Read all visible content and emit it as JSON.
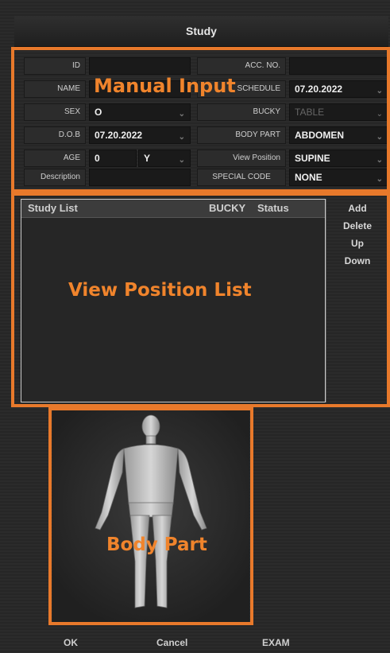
{
  "window": {
    "title": "Study"
  },
  "overlays": {
    "manual_input": "Manual Input",
    "view_position_list": "View Position List",
    "body_part": "Body Part"
  },
  "form": {
    "id": {
      "label": "ID",
      "value": ""
    },
    "name": {
      "label": "NAME",
      "value": ""
    },
    "sex": {
      "label": "SEX",
      "value": "O"
    },
    "dob": {
      "label": "D.O.B",
      "value": "07.20.2022"
    },
    "age": {
      "label": "AGE",
      "value": "0",
      "unit": "Y"
    },
    "description": {
      "label": "Description",
      "value": ""
    },
    "acc_no": {
      "label": "ACC. NO.",
      "value": ""
    },
    "schedule": {
      "label": "SCHEDULE",
      "value": "07.20.2022"
    },
    "bucky": {
      "label": "BUCKY",
      "value": "TABLE"
    },
    "body_part": {
      "label": "BODY PART",
      "value": "ABDOMEN"
    },
    "view_position": {
      "label": "View Position",
      "value": "SUPINE"
    },
    "special_code": {
      "label": "SPECIAL CODE",
      "value": "NONE"
    }
  },
  "study_list": {
    "columns": [
      "Study List",
      "BUCKY",
      "Status"
    ],
    "rows": []
  },
  "side_buttons": {
    "add": "Add",
    "delete": "Delete",
    "up": "Up",
    "down": "Down"
  },
  "footer": {
    "ok": "OK",
    "cancel": "Cancel",
    "exam": "EXAM"
  },
  "colors": {
    "accent": "#e8792b",
    "panel": "#2b2b2b",
    "field": "#1a1a1a"
  }
}
